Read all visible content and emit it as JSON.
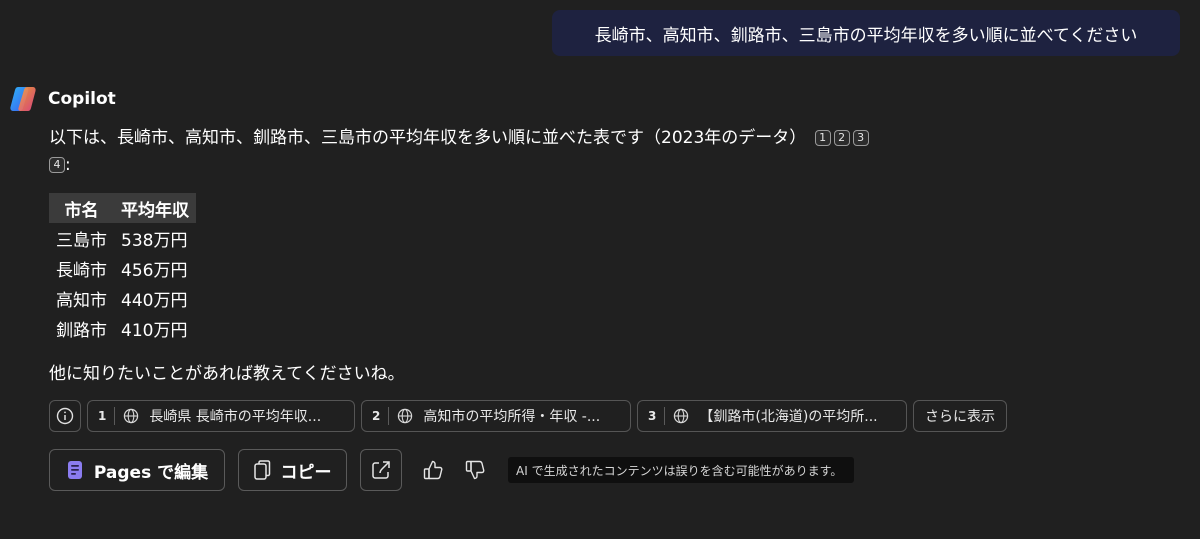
{
  "user_message": "長崎市、高知市、釧路市、三島市の平均年収を多い順に並べてください",
  "assistant": {
    "name": "Copilot",
    "intro": "以下は、長崎市、高知市、釧路市、三島市の平均年収を多い順に並べた表です（2023年のデータ）",
    "citations": [
      "1",
      "2",
      "3",
      "4"
    ],
    "intro_suffix": ":",
    "table": {
      "headers": [
        "市名",
        "平均年収"
      ],
      "rows": [
        [
          "三島市",
          "538万円"
        ],
        [
          "長崎市",
          "456万円"
        ],
        [
          "高知市",
          "440万円"
        ],
        [
          "釧路市",
          "410万円"
        ]
      ]
    },
    "outro": "他に知りたいことがあれば教えてくださいね。"
  },
  "sources": {
    "items": [
      {
        "num": "1",
        "label": "長崎県 長崎市の平均年収..."
      },
      {
        "num": "2",
        "label": "高知市の平均所得・年収 -..."
      },
      {
        "num": "3",
        "label": "【釧路市(北海道)の平均所..."
      }
    ],
    "more_label": "さらに表示"
  },
  "actions": {
    "pages_label": "Pages で編集",
    "copy_label": "コピー"
  },
  "disclaimer": "AI で生成されたコンテンツは誤りを含む可能性があります。",
  "colors": {
    "background": "#202020",
    "user_bubble": "#1e2240",
    "pages_icon": "#8b7cf0",
    "border": "#5a5a5a"
  }
}
